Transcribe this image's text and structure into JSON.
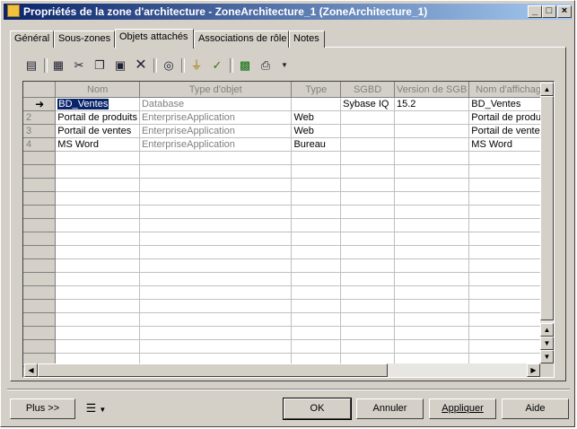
{
  "window": {
    "title": "Propriétés de la zone d'architecture - ZoneArchitecture_1 (ZoneArchitecture_1)",
    "controls": [
      "_",
      "□",
      "×"
    ]
  },
  "tabs": [
    {
      "label": "Général"
    },
    {
      "label": "Sous-zones"
    },
    {
      "label": "Objets attachés",
      "active": true
    },
    {
      "label": "Associations de rôle"
    },
    {
      "label": "Notes"
    }
  ],
  "toolbar": {
    "icons": [
      "properties-icon",
      "add-objects-icon",
      "cut-icon",
      "copy-icon",
      "paste-icon",
      "delete-icon",
      "find-icon",
      "filter-icon",
      "clear-filter-icon",
      "excel-icon",
      "print-icon",
      "dropdown-icon"
    ]
  },
  "grid": {
    "columns": [
      "Nom",
      "Type d'objet",
      "Type",
      "SGBD",
      "Version de SGB",
      "Nom d'affichage"
    ],
    "rows": [
      {
        "marker": "➜",
        "name": "BD_Ventes",
        "object_type": "Database",
        "type": "",
        "sgbd": "Sybase IQ",
        "version": "15.2",
        "display": "BD_Ventes"
      },
      {
        "marker": "2",
        "name": "Portail de produits",
        "object_type": "EnterpriseApplication",
        "type": "Web",
        "sgbd": "",
        "version": "",
        "display": "Portail de produits"
      },
      {
        "marker": "3",
        "name": "Portail de ventes",
        "object_type": "EnterpriseApplication",
        "type": "Web",
        "sgbd": "",
        "version": "",
        "display": "Portail de ventes"
      },
      {
        "marker": "4",
        "name": "MS Word",
        "object_type": "EnterpriseApplication",
        "type": "Bureau",
        "sgbd": "",
        "version": "",
        "display": "MS Word"
      }
    ],
    "empty_rows": 17
  },
  "buttons": {
    "more": "Plus >>",
    "ok": "OK",
    "cancel": "Annuler",
    "apply": "Appliquer",
    "help": "Aide"
  }
}
